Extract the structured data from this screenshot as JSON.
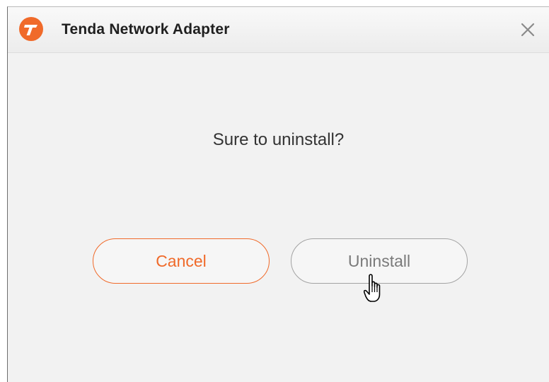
{
  "window": {
    "title": "Tenda Network Adapter"
  },
  "icons": {
    "logo": "tenda-logo-icon",
    "close": "close-icon",
    "cursor": "hand-pointer-cursor"
  },
  "dialog": {
    "message": "Sure to uninstall?"
  },
  "buttons": {
    "cancel_label": "Cancel",
    "uninstall_label": "Uninstall"
  },
  "colors": {
    "accent": "#f06a2a",
    "secondary_button": "#a3a3a3",
    "background": "#f2f2f2"
  }
}
